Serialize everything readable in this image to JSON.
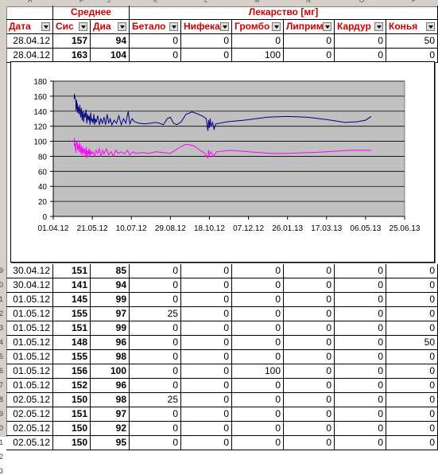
{
  "sheet": {
    "column_letters": [
      "A",
      "F",
      "J",
      "K",
      "L",
      "M",
      "N",
      "O",
      "P"
    ],
    "header_top": {
      "average": "Среднее",
      "drug": "Лекарство [мг]"
    },
    "columns": [
      {
        "label": "Дата"
      },
      {
        "label": "Сис"
      },
      {
        "label": "Диа"
      },
      {
        "label": "Бетало"
      },
      {
        "label": "Нифека"
      },
      {
        "label": "Громбо"
      },
      {
        "label": "Липрим"
      },
      {
        "label": "Кардур"
      },
      {
        "label": "Конья"
      }
    ],
    "rows_top": [
      [
        "28.04.12",
        "157",
        "94",
        "0",
        "0",
        "0",
        "0",
        "0",
        "50"
      ],
      [
        "28.04.12",
        "163",
        "104",
        "0",
        "0",
        "100",
        "0",
        "0",
        "0"
      ]
    ],
    "rows_bottom": [
      [
        "30.04.12",
        "151",
        "85",
        "0",
        "0",
        "0",
        "0",
        "0",
        "0"
      ],
      [
        "30.04.12",
        "141",
        "94",
        "0",
        "0",
        "0",
        "0",
        "0",
        "0"
      ],
      [
        "01.05.12",
        "145",
        "99",
        "0",
        "0",
        "0",
        "0",
        "0",
        "0"
      ],
      [
        "01.05.12",
        "155",
        "97",
        "25",
        "0",
        "0",
        "0",
        "0",
        "0"
      ],
      [
        "01.05.12",
        "151",
        "99",
        "0",
        "0",
        "0",
        "0",
        "0",
        "0"
      ],
      [
        "01.05.12",
        "148",
        "96",
        "0",
        "0",
        "0",
        "0",
        "0",
        "50"
      ],
      [
        "01.05.12",
        "155",
        "98",
        "0",
        "0",
        "0",
        "0",
        "0",
        "0"
      ],
      [
        "01.05.12",
        "156",
        "100",
        "0",
        "0",
        "100",
        "0",
        "0",
        "0"
      ],
      [
        "01.05.12",
        "152",
        "96",
        "0",
        "0",
        "0",
        "0",
        "0",
        "0"
      ],
      [
        "02.05.12",
        "150",
        "98",
        "25",
        "0",
        "0",
        "0",
        "0",
        "0"
      ],
      [
        "02.05.12",
        "151",
        "97",
        "0",
        "0",
        "0",
        "0",
        "0",
        "0"
      ],
      [
        "02.05.12",
        "150",
        "92",
        "0",
        "0",
        "0",
        "0",
        "0",
        "0"
      ],
      [
        "02.05.12",
        "150",
        "95",
        "0",
        "0",
        "0",
        "0",
        "0",
        "0"
      ]
    ],
    "row_numbers": [
      "9",
      "0",
      "1",
      "2",
      "3",
      "4",
      "5",
      "6",
      "7",
      "8",
      "9",
      "0",
      "1",
      "2",
      "3"
    ]
  },
  "chart_data": {
    "type": "line",
    "title": "",
    "xlabel": "",
    "ylabel": "",
    "ylim": [
      0,
      180
    ],
    "yticks": [
      "0",
      "20",
      "40",
      "60",
      "80",
      "100",
      "120",
      "140",
      "160",
      "180"
    ],
    "xticks": [
      "01.04.12",
      "21.05.12",
      "10.07.12",
      "29.08.12",
      "18.10.12",
      "07.12.12",
      "26.01.13",
      "17.03.13",
      "06.05.13",
      "25.06.13"
    ],
    "grid": true,
    "legend": "none",
    "plot_background": "#c0c0c0",
    "series": [
      {
        "color": "#000080",
        "points": [
          [
            "2012-04-28",
            157
          ],
          [
            "2012-04-28",
            163
          ],
          [
            "2012-04-30",
            151
          ],
          [
            "2012-04-30",
            141
          ],
          [
            "2012-05-01",
            145
          ],
          [
            "2012-05-01",
            155
          ],
          [
            "2012-05-01",
            151
          ],
          [
            "2012-05-01",
            148
          ],
          [
            "2012-05-02",
            150
          ],
          [
            "2012-05-02",
            138
          ],
          [
            "2012-05-03",
            146
          ],
          [
            "2012-05-04",
            136
          ],
          [
            "2012-05-05",
            148
          ],
          [
            "2012-05-06",
            132
          ],
          [
            "2012-05-07",
            144
          ],
          [
            "2012-05-08",
            128
          ],
          [
            "2012-05-09",
            140
          ],
          [
            "2012-05-10",
            126
          ],
          [
            "2012-05-11",
            138
          ],
          [
            "2012-05-12",
            132
          ],
          [
            "2012-05-13",
            142
          ],
          [
            "2012-05-14",
            124
          ],
          [
            "2012-05-15",
            136
          ],
          [
            "2012-05-16",
            128
          ],
          [
            "2012-05-17",
            134
          ],
          [
            "2012-05-18",
            122
          ],
          [
            "2012-05-19",
            138
          ],
          [
            "2012-05-20",
            126
          ],
          [
            "2012-05-21",
            130
          ],
          [
            "2012-05-22",
            124
          ],
          [
            "2012-05-23",
            136
          ],
          [
            "2012-05-24",
            122
          ],
          [
            "2012-05-25",
            130
          ],
          [
            "2012-05-26",
            125
          ],
          [
            "2012-05-28",
            134
          ],
          [
            "2012-05-30",
            122
          ],
          [
            "2012-06-01",
            130
          ],
          [
            "2012-06-03",
            124
          ],
          [
            "2012-06-05",
            132
          ],
          [
            "2012-06-07",
            122
          ],
          [
            "2012-06-09",
            136
          ],
          [
            "2012-06-11",
            124
          ],
          [
            "2012-06-13",
            130
          ],
          [
            "2012-06-15",
            122
          ],
          [
            "2012-06-18",
            128
          ],
          [
            "2012-06-21",
            124
          ],
          [
            "2012-06-24",
            134
          ],
          [
            "2012-06-27",
            122
          ],
          [
            "2012-06-30",
            130
          ],
          [
            "2012-07-03",
            124
          ],
          [
            "2012-07-06",
            140
          ],
          [
            "2012-07-08",
            123
          ],
          [
            "2012-07-11",
            130
          ],
          [
            "2012-07-14",
            126
          ],
          [
            "2012-07-20",
            124
          ],
          [
            "2012-07-27",
            123
          ],
          [
            "2012-08-03",
            124
          ],
          [
            "2012-08-10",
            125
          ],
          [
            "2012-08-15",
            124
          ],
          [
            "2012-08-20",
            122
          ],
          [
            "2012-08-25",
            130
          ],
          [
            "2012-08-29",
            132
          ],
          [
            "2012-09-02",
            124
          ],
          [
            "2012-09-06",
            122
          ],
          [
            "2012-09-12",
            126
          ],
          [
            "2012-09-18",
            136
          ],
          [
            "2012-09-26",
            139
          ],
          [
            "2012-10-04",
            136
          ],
          [
            "2012-10-10",
            133
          ],
          [
            "2012-10-14",
            130
          ],
          [
            "2012-10-16",
            114
          ],
          [
            "2012-10-17",
            128
          ],
          [
            "2012-10-18",
            118
          ],
          [
            "2012-10-19",
            130
          ],
          [
            "2012-10-20",
            120
          ],
          [
            "2012-10-22",
            125
          ],
          [
            "2012-10-24",
            116
          ],
          [
            "2012-10-26",
            123
          ],
          [
            "2012-11-10",
            126
          ],
          [
            "2012-12-01",
            128
          ],
          [
            "2013-01-01",
            132
          ],
          [
            "2013-01-26",
            133
          ],
          [
            "2013-02-20",
            132
          ],
          [
            "2013-03-17",
            129
          ],
          [
            "2013-04-10",
            125
          ],
          [
            "2013-04-25",
            126
          ],
          [
            "2013-05-06",
            128
          ],
          [
            "2013-05-13",
            133
          ]
        ]
      },
      {
        "color": "#ff00ff",
        "points": [
          [
            "2012-04-28",
            94
          ],
          [
            "2012-04-28",
            104
          ],
          [
            "2012-04-30",
            85
          ],
          [
            "2012-04-30",
            94
          ],
          [
            "2012-05-01",
            99
          ],
          [
            "2012-05-01",
            97
          ],
          [
            "2012-05-01",
            99
          ],
          [
            "2012-05-01",
            96
          ],
          [
            "2012-05-02",
            98
          ],
          [
            "2012-05-02",
            88
          ],
          [
            "2012-05-03",
            96
          ],
          [
            "2012-05-04",
            86
          ],
          [
            "2012-05-05",
            98
          ],
          [
            "2012-05-06",
            84
          ],
          [
            "2012-05-07",
            94
          ],
          [
            "2012-05-08",
            82
          ],
          [
            "2012-05-09",
            92
          ],
          [
            "2012-05-10",
            84
          ],
          [
            "2012-05-11",
            90
          ],
          [
            "2012-05-12",
            80
          ],
          [
            "2012-05-13",
            92
          ],
          [
            "2012-05-14",
            78
          ],
          [
            "2012-05-15",
            88
          ],
          [
            "2012-05-16",
            82
          ],
          [
            "2012-05-17",
            90
          ],
          [
            "2012-05-18",
            80
          ],
          [
            "2012-05-19",
            88
          ],
          [
            "2012-05-20",
            83
          ],
          [
            "2012-05-22",
            86
          ],
          [
            "2012-05-24",
            80
          ],
          [
            "2012-05-26",
            88
          ],
          [
            "2012-05-28",
            84
          ],
          [
            "2012-05-30",
            90
          ],
          [
            "2012-06-01",
            80
          ],
          [
            "2012-06-03",
            88
          ],
          [
            "2012-06-05",
            83
          ],
          [
            "2012-06-08",
            90
          ],
          [
            "2012-06-11",
            82
          ],
          [
            "2012-06-14",
            86
          ],
          [
            "2012-06-17",
            80
          ],
          [
            "2012-06-20",
            88
          ],
          [
            "2012-06-23",
            84
          ],
          [
            "2012-06-27",
            86
          ],
          [
            "2012-07-01",
            83
          ],
          [
            "2012-07-05",
            88
          ],
          [
            "2012-07-08",
            82
          ],
          [
            "2012-07-12",
            86
          ],
          [
            "2012-07-16",
            84
          ],
          [
            "2012-07-24",
            85
          ],
          [
            "2012-08-01",
            84
          ],
          [
            "2012-08-10",
            86
          ],
          [
            "2012-08-20",
            85
          ],
          [
            "2012-08-29",
            84
          ],
          [
            "2012-09-04",
            88
          ],
          [
            "2012-09-10",
            92
          ],
          [
            "2012-09-18",
            96
          ],
          [
            "2012-09-28",
            94
          ],
          [
            "2012-10-06",
            88
          ],
          [
            "2012-10-12",
            84
          ],
          [
            "2012-10-16",
            78
          ],
          [
            "2012-10-17",
            88
          ],
          [
            "2012-10-18",
            82
          ],
          [
            "2012-10-20",
            86
          ],
          [
            "2012-10-23",
            80
          ],
          [
            "2012-10-27",
            86
          ],
          [
            "2012-11-15",
            88
          ],
          [
            "2012-12-07",
            86
          ],
          [
            "2013-01-05",
            84
          ],
          [
            "2013-01-26",
            84
          ],
          [
            "2013-02-25",
            85
          ],
          [
            "2013-03-17",
            86
          ],
          [
            "2013-04-15",
            88
          ],
          [
            "2013-05-06",
            88
          ],
          [
            "2013-05-13",
            88
          ]
        ]
      }
    ]
  }
}
